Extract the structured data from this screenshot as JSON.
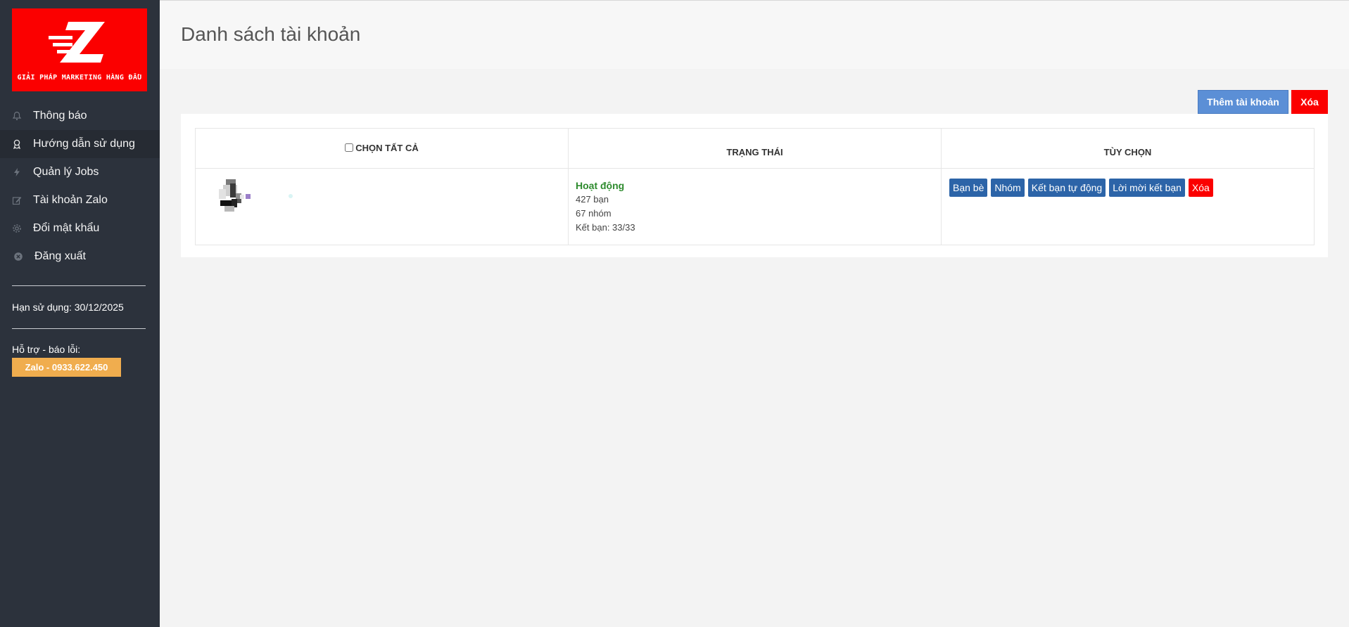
{
  "sidebar": {
    "logo_tagline": "GIẢI PHÁP MARKETING HÀNG ĐẦU",
    "items": [
      {
        "label": "Thông báo",
        "icon": "bell-icon"
      },
      {
        "label": "Hướng dẫn sử dụng",
        "icon": "award-icon",
        "active": true
      },
      {
        "label": "Quản lý Jobs",
        "icon": "bolt-icon"
      },
      {
        "label": "Tài khoản Zalo",
        "icon": "edit-icon"
      },
      {
        "label": "Đổi mật khẩu",
        "icon": "gear-icon"
      },
      {
        "label": "Đăng xuất",
        "icon": "close-circle-icon"
      }
    ],
    "expiry": "Hạn sử dụng: 30/12/2025",
    "support_label": "Hỗ trợ - báo lỗi:",
    "zalo_button": "Zalo - 0933.622.450"
  },
  "header": {
    "title": "Danh sách tài khoản"
  },
  "toolbar": {
    "add_label": "Thêm tài khoản",
    "delete_label": "Xóa"
  },
  "table": {
    "columns": {
      "select_all": "CHỌN TẤT CẢ",
      "status": "TRẠNG THÁI",
      "options": "TÙY CHỌN"
    },
    "rows": [
      {
        "status": "Hoạt động",
        "friends": "427 bạn",
        "groups": "67 nhóm",
        "invites": "Kết bạn: 33/33",
        "actions": {
          "friends": "Bạn bè",
          "groups": "Nhóm",
          "auto_add": "Kết bạn tự động",
          "invitations": "Lời mời kết bạn",
          "delete": "Xóa"
        }
      }
    ]
  },
  "colors": {
    "sidebar_bg": "#2c323c",
    "brand_red": "#fb0000",
    "accent_blue": "#2c64a8",
    "add_button_blue": "#5b8fd6",
    "zalo_orange": "#f0ad4e",
    "status_green": "#2e8b2e"
  }
}
